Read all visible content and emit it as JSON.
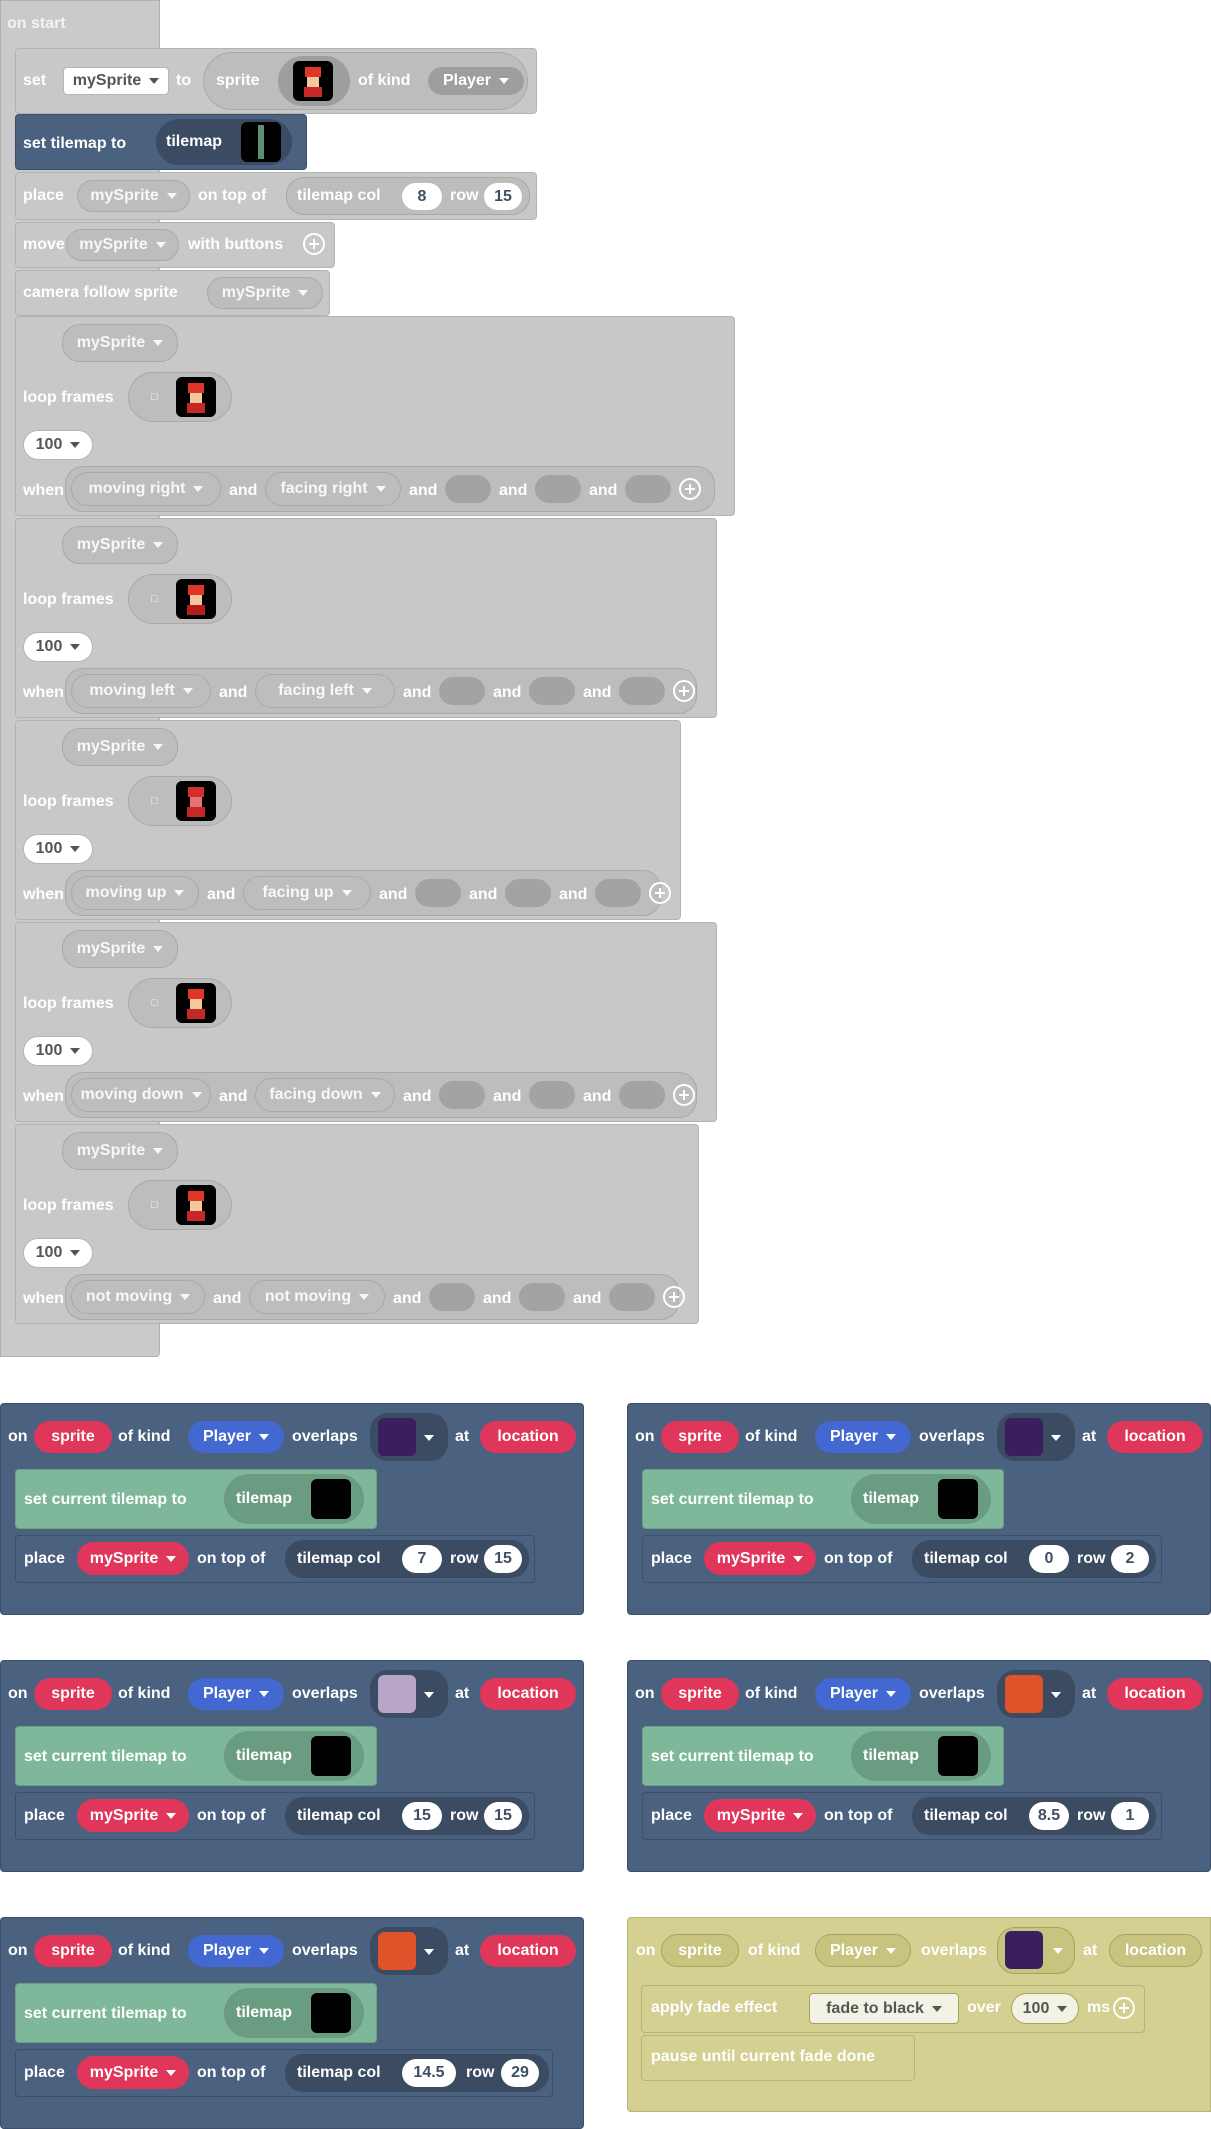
{
  "on_start": {
    "hat": "on start",
    "set": {
      "set": "set",
      "var": "mySprite",
      "to": "to",
      "sprite": "sprite",
      "of_kind": "of kind",
      "kind": "Player"
    },
    "set_tilemap": {
      "label": "set tilemap to",
      "tilemap": "tilemap"
    },
    "place": {
      "place": "place",
      "var": "mySprite",
      "on_top_of": "on top of",
      "tilemap_col": "tilemap col",
      "col": "8",
      "row_label": "row",
      "row": "15"
    },
    "move": {
      "move": "move",
      "var": "mySprite",
      "with_buttons": "with buttons"
    },
    "camera": {
      "label": "camera follow sprite",
      "var": "mySprite"
    },
    "animations": [
      {
        "var": "mySprite",
        "loop_frames": "loop frames",
        "interval": "100",
        "when": "when",
        "cond1": "moving right",
        "and": "and",
        "cond2": "facing right"
      },
      {
        "var": "mySprite",
        "loop_frames": "loop frames",
        "interval": "100",
        "when": "when",
        "cond1": "moving left",
        "and": "and",
        "cond2": "facing left"
      },
      {
        "var": "mySprite",
        "loop_frames": "loop frames",
        "interval": "100",
        "when": "when",
        "cond1": "moving up",
        "and": "and",
        "cond2": "facing up"
      },
      {
        "var": "mySprite",
        "loop_frames": "loop frames",
        "interval": "100",
        "when": "when",
        "cond1": "moving down",
        "and": "and",
        "cond2": "facing down"
      },
      {
        "var": "mySprite",
        "loop_frames": "loop frames",
        "interval": "100",
        "when": "when",
        "cond1": "not moving",
        "and": "and",
        "cond2": "not moving"
      }
    ]
  },
  "events": [
    {
      "on": "on",
      "sprite": "sprite",
      "of_kind": "of kind",
      "kind": "Player",
      "overlaps": "overlaps",
      "at": "at",
      "location": "location",
      "set_current": "set current tilemap to",
      "tilemap": "tilemap",
      "place": "place",
      "var": "mySprite",
      "on_top_of": "on top of",
      "tilemap_col": "tilemap col",
      "col": "7",
      "row_label": "row",
      "row": "15"
    },
    {
      "on": "on",
      "sprite": "sprite",
      "of_kind": "of kind",
      "kind": "Player",
      "overlaps": "overlaps",
      "at": "at",
      "location": "location",
      "set_current": "set current tilemap to",
      "tilemap": "tilemap",
      "place": "place",
      "var": "mySprite",
      "on_top_of": "on top of",
      "tilemap_col": "tilemap col",
      "col": "0",
      "row_label": "row",
      "row": "2"
    },
    {
      "on": "on",
      "sprite": "sprite",
      "of_kind": "of kind",
      "kind": "Player",
      "overlaps": "overlaps",
      "at": "at",
      "location": "location",
      "set_current": "set current tilemap to",
      "tilemap": "tilemap",
      "place": "place",
      "var": "mySprite",
      "on_top_of": "on top of",
      "tilemap_col": "tilemap col",
      "col": "15",
      "row_label": "row",
      "row": "15"
    },
    {
      "on": "on",
      "sprite": "sprite",
      "of_kind": "of kind",
      "kind": "Player",
      "overlaps": "overlaps",
      "at": "at",
      "location": "location",
      "set_current": "set current tilemap to",
      "tilemap": "tilemap",
      "place": "place",
      "var": "mySprite",
      "on_top_of": "on top of",
      "tilemap_col": "tilemap col",
      "col": "8.5",
      "row_label": "row",
      "row": "1"
    },
    {
      "on": "on",
      "sprite": "sprite",
      "of_kind": "of kind",
      "kind": "Player",
      "overlaps": "overlaps",
      "at": "at",
      "location": "location",
      "set_current": "set current tilemap to",
      "tilemap": "tilemap",
      "place": "place",
      "var": "mySprite",
      "on_top_of": "on top of",
      "tilemap_col": "tilemap col",
      "col": "14.5",
      "row_label": "row",
      "row": "29"
    }
  ],
  "fade_event": {
    "on": "on",
    "sprite": "sprite",
    "of_kind": "of kind",
    "kind": "Player",
    "overlaps": "overlaps",
    "at": "at",
    "location": "location",
    "apply": "apply fade effect",
    "effect": "fade to black",
    "over": "over",
    "ms_value": "100",
    "ms": "ms",
    "pause": "pause until current fade done"
  },
  "colors": {
    "event_block": "#4a6180",
    "tilemap_block": "#7fb79a",
    "sprite_red": "#e0365a",
    "kind_blue": "#4368d1",
    "disabled_grey": "#c8c8c8",
    "fade_olive": "#d3d091"
  }
}
